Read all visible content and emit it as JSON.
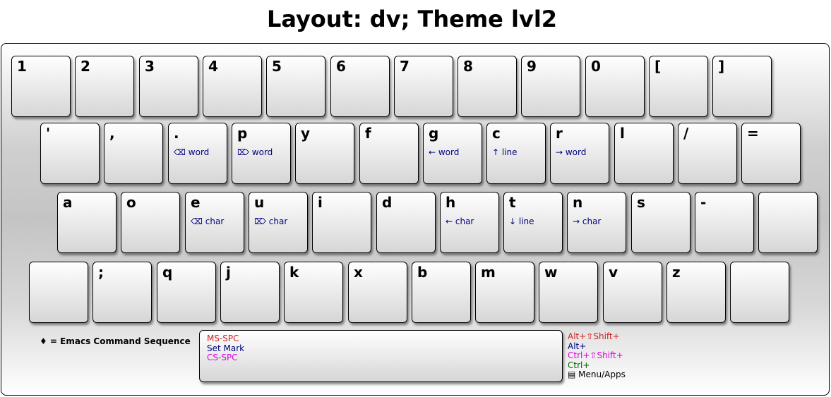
{
  "title": "Layout: dv; Theme lvl2",
  "colors": {
    "red": "#cc2222",
    "navy": "#000080",
    "magenta": "#dd00dd",
    "green": "#006600",
    "black": "#000000"
  },
  "rows": [
    [
      {
        "label": "1"
      },
      {
        "label": "2"
      },
      {
        "label": "3"
      },
      {
        "label": "4"
      },
      {
        "label": "5"
      },
      {
        "label": "6"
      },
      {
        "label": "7"
      },
      {
        "label": "8"
      },
      {
        "label": "9"
      },
      {
        "label": "0"
      },
      {
        "label": "["
      },
      {
        "label": "]"
      }
    ],
    [
      {
        "label": "'"
      },
      {
        "label": ","
      },
      {
        "label": ".",
        "sub": "⌫ word"
      },
      {
        "label": "p",
        "sub": "⌦ word"
      },
      {
        "label": "y"
      },
      {
        "label": "f"
      },
      {
        "label": "g",
        "sub": "← word"
      },
      {
        "label": "c",
        "sub": "↑ line"
      },
      {
        "label": "r",
        "sub": "→ word"
      },
      {
        "label": "l"
      },
      {
        "label": "/"
      },
      {
        "label": "="
      }
    ],
    [
      {
        "label": "a"
      },
      {
        "label": "o"
      },
      {
        "label": "e",
        "sub": "⌫ char"
      },
      {
        "label": "u",
        "sub": "⌦ char"
      },
      {
        "label": "i"
      },
      {
        "label": "d"
      },
      {
        "label": "h",
        "sub": "← char"
      },
      {
        "label": "t",
        "sub": "↓ line"
      },
      {
        "label": "n",
        "sub": "→ char"
      },
      {
        "label": "s"
      },
      {
        "label": "-"
      },
      {
        "label": ""
      }
    ],
    [
      {
        "label": ""
      },
      {
        "label": ";"
      },
      {
        "label": "q"
      },
      {
        "label": "j"
      },
      {
        "label": "k"
      },
      {
        "label": "x"
      },
      {
        "label": "b"
      },
      {
        "label": "m"
      },
      {
        "label": "w"
      },
      {
        "label": "v"
      },
      {
        "label": "z"
      },
      {
        "label": ""
      }
    ]
  ],
  "space": {
    "line1": "MS-SPC",
    "line2": "Set Mark",
    "line3": "CS-SPC"
  },
  "note": "♦ = Emacs Command Sequence",
  "legend": {
    "l1": "Alt+⇧Shift+",
    "l2": "Alt+",
    "l3": "Ctrl+⇧Shift+",
    "l4": "Ctrl+",
    "l5": "▤ Menu/Apps"
  }
}
